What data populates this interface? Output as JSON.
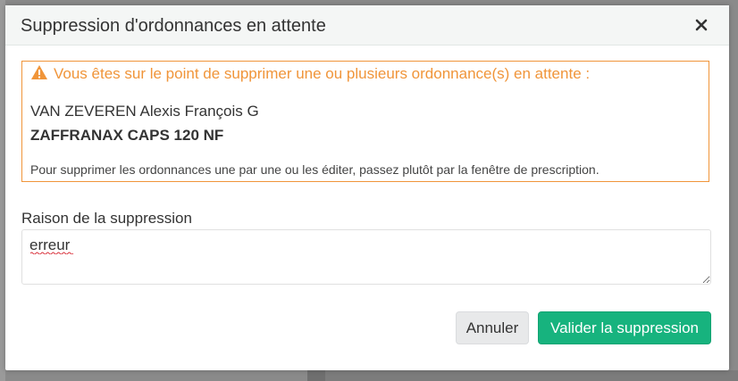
{
  "dialog": {
    "title": "Suppression d'ordonnances en attente",
    "close_icon": "close-icon"
  },
  "warning": {
    "icon": "warning-triangle-icon",
    "message": "Vous êtes sur le point de supprimer une ou plusieurs ordonnance(s) en attente :",
    "patient_name": "VAN ZEVEREN Alexis François G",
    "drug_name": "ZAFFRANAX CAPS 120 NF",
    "info": "Pour supprimer les ordonnances une par une ou les éditer, passez plutôt par la fenêtre de prescription."
  },
  "reason": {
    "label": "Raison de la suppression",
    "value": "erreur"
  },
  "buttons": {
    "cancel": "Annuler",
    "confirm": "Valider la suppression"
  },
  "colors": {
    "warning": "#f0953a",
    "confirm": "#17b37e"
  }
}
